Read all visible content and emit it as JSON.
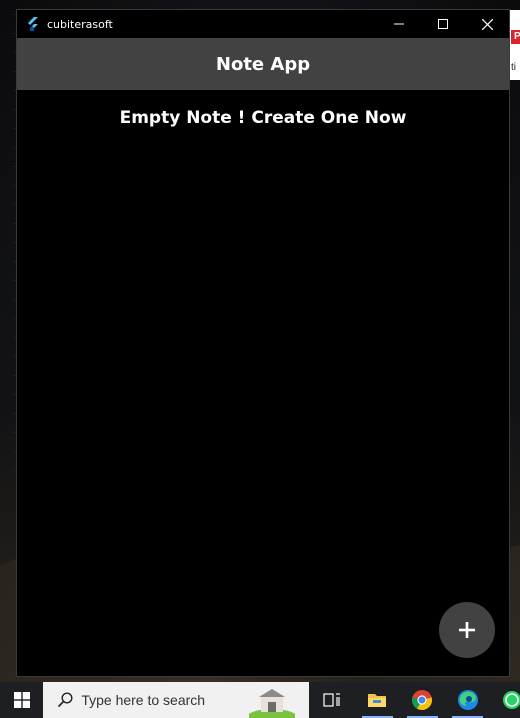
{
  "window": {
    "app_name": "cubiterasoft",
    "minimize_label": "Minimize",
    "maximize_label": "Maximize",
    "close_label": "Close"
  },
  "appbar": {
    "title": "Note App"
  },
  "main": {
    "empty_message": "Empty Note ! Create One Now"
  },
  "fab": {
    "icon": "plus-icon"
  },
  "side_window": {
    "badge": "P",
    "text": "ti"
  },
  "taskbar": {
    "search_placeholder": "Type here to search",
    "icons": [
      "windows-start-icon",
      "search-icon",
      "task-view-icon",
      "file-explorer-icon",
      "chrome-icon",
      "edge-icon",
      "whatsapp-icon"
    ]
  },
  "colors": {
    "app_background": "#000000",
    "appbar": "#424242",
    "fab": "#424242",
    "text": "#ffffff",
    "taskbar": "#1d1f22"
  }
}
